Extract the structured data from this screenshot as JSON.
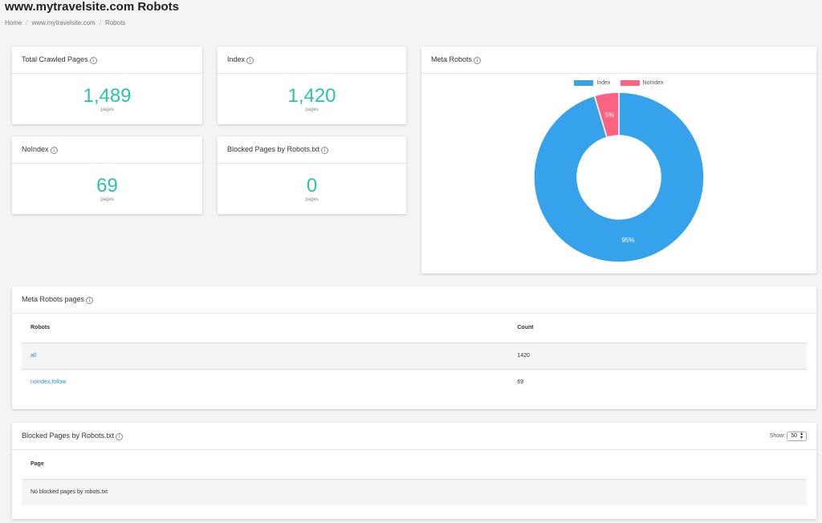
{
  "header": {
    "title": "www.mytravelsite.com Robots",
    "breadcrumb": [
      "Home",
      "www.mytravelsite.com",
      "Robots"
    ]
  },
  "stats": [
    {
      "title": "Total Crawled Pages",
      "value": "1,489",
      "unit": "pages"
    },
    {
      "title": "Index",
      "value": "1,420",
      "unit": "pages"
    },
    {
      "title": "NoIndex",
      "value": "69",
      "unit": "pages"
    },
    {
      "title": "Blocked Pages by Robots.txt",
      "value": "0",
      "unit": "pages"
    }
  ],
  "meta_robots_chart": {
    "title": "Meta Robots",
    "legend": [
      "Index",
      "NoIndex"
    ],
    "labels": [
      "95%",
      "5%"
    ]
  },
  "chart_data": {
    "type": "pie",
    "title": "Meta Robots",
    "categories": [
      "Index",
      "NoIndex"
    ],
    "values": [
      1420,
      69
    ],
    "percent_labels": [
      "95%",
      "5%"
    ],
    "colors": [
      "#36a2eb",
      "#ff6384"
    ],
    "legend_position": "top"
  },
  "meta_robots_table": {
    "title": "Meta Robots pages",
    "columns": [
      "Robots",
      "Count"
    ],
    "rows": [
      {
        "robots": "all",
        "count": "1420"
      },
      {
        "robots": "noindex,follow",
        "count": "69"
      }
    ]
  },
  "blocked_table": {
    "title": "Blocked Pages by Robots.txt",
    "show_label": "Show:",
    "show_value": "50",
    "columns": [
      "Page"
    ],
    "empty_text": "No blocked pages by robots.txt"
  },
  "icons": {
    "info": "info-icon",
    "select": "select-arrows-icon"
  }
}
